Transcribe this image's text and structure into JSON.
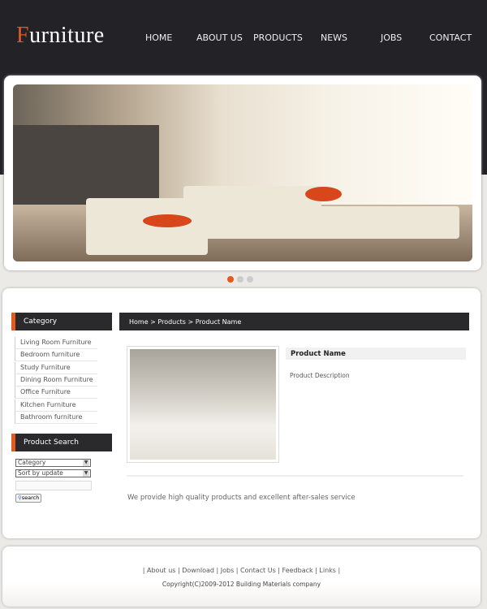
{
  "header": {
    "logo_first": "F",
    "logo_rest": "urniture",
    "nav": [
      "HOME",
      "ABOUT US",
      "PRODUCTS",
      "NEWS",
      "JOBS",
      "CONTACT"
    ]
  },
  "banner": {
    "slides": 3,
    "active": 1
  },
  "sidebar": {
    "category_title": "Category",
    "categories": [
      "Living Room Furniture",
      "Bedroom furniture",
      "Study Furniture",
      "Dining Room Furniture",
      "Office Furniture",
      "Kitchen Furniture",
      "Bathroom furniture"
    ],
    "search_title": "Product Search",
    "category_select": "Category",
    "sort_select": "Sort by update",
    "search_button": "search"
  },
  "content": {
    "breadcrumb": "Home > Products > Product Name",
    "product_name": "Product Name",
    "product_description": "Product Description",
    "tagline": "We provide high quality products and excellent after-sales service"
  },
  "footer": {
    "links": [
      "About us",
      "Download",
      "Jobs",
      "Contact Us",
      "Feedback",
      "Links"
    ],
    "copyright": "Copyright(C)2009-2012 Building Materials company"
  },
  "colors": {
    "accent": "#e35a1f",
    "dark": "#232227"
  }
}
